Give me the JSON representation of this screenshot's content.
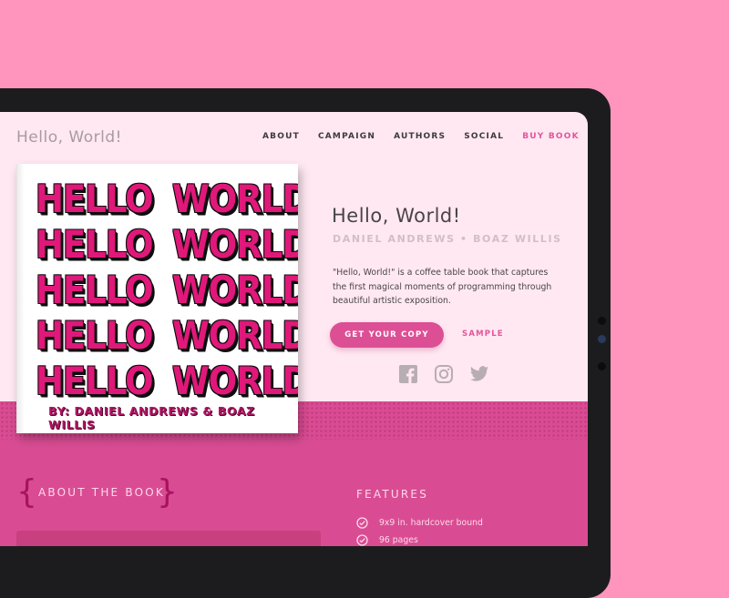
{
  "brand": "Hello, World!",
  "nav": [
    "ABOUT",
    "CAMPAIGN",
    "AUTHORS",
    "SOCIAL",
    "BUY BOOK"
  ],
  "hero": {
    "title": "Hello, World!",
    "authors": "DANIEL ANDREWS • BOAZ WILLIS",
    "description": "\"Hello, World!\" is a coffee table book that captures the first magical moments of programming through beautiful artistic exposition.",
    "cta": "GET YOUR COPY",
    "sample": "SAMPLE",
    "social_icons": [
      "facebook-icon",
      "instagram-icon",
      "twitter-icon"
    ]
  },
  "book_cover": {
    "lines": [
      {
        "w1": "HELLO",
        "w2": "WORLD!"
      },
      {
        "w1": "HELLO",
        "w2": "WORLD!"
      },
      {
        "w1": "HELLO",
        "w2": "WORLD!"
      },
      {
        "w1": "HELLO",
        "w2": "WORLD!"
      },
      {
        "w1": "HELLO",
        "w2": "WORLD!"
      }
    ],
    "byline": "BY: DANIEL ANDREWS & BOAZ WILLIS"
  },
  "about": {
    "title": "ABOUT THE BOOK"
  },
  "features": {
    "title": "FEATURES",
    "items": [
      "9x9 in. hardcover bound",
      "96 pages"
    ]
  },
  "colors": {
    "background": "#ff94bd",
    "accent": "#dd4f95",
    "screen": "#ffe8f2",
    "cover_ink": "#e0187a"
  }
}
